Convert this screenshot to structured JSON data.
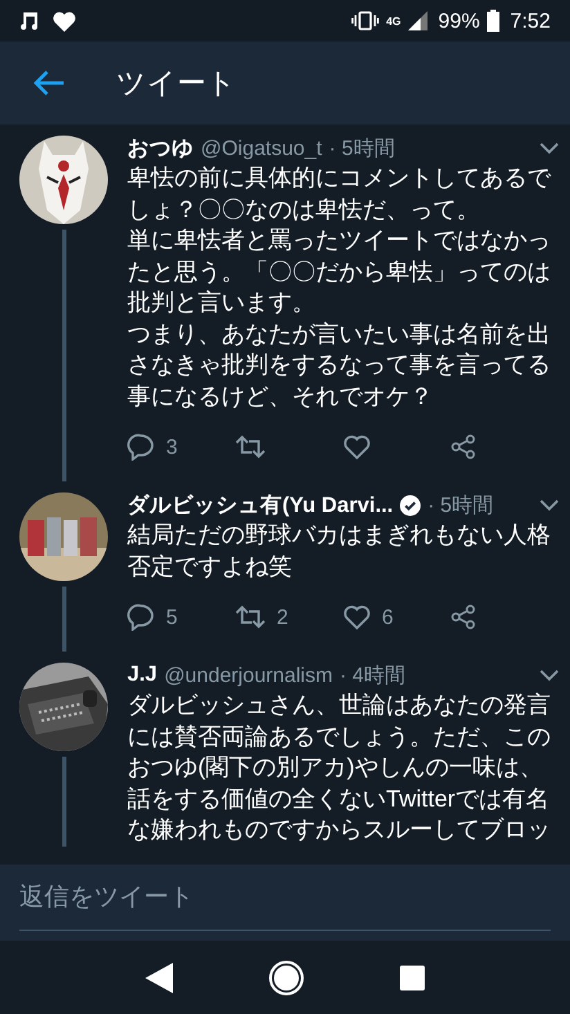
{
  "status_bar": {
    "battery": "99%",
    "time": "7:52",
    "network": "4G"
  },
  "header": {
    "title": "ツイート"
  },
  "tweets": [
    {
      "name": "おつゆ",
      "verified": false,
      "handle": "@Oigatsuo_t",
      "time": "· 5時間",
      "lines": [
        "卑怯の前に具体的にコメントしてあるで",
        "しょ？〇〇なのは卑怯だ、って。",
        "単に卑怯者と罵ったツイートではなかっ",
        "たと思う。「〇〇だから卑怯」ってのは",
        "批判と言います。",
        "つまり、あなたが言いたい事は名前を出",
        "さなきゃ批判をするなって事を言ってる",
        "事になるけど、それでオケ？"
      ],
      "replies": "3"
    },
    {
      "name": "ダルビッシュ有(Yu Darvi...",
      "verified": true,
      "time": "· 5時間",
      "lines": [
        "結局ただの野球バカはまぎれもない人格",
        "否定ですよね笑"
      ],
      "replies": "5",
      "retweets": "2",
      "likes": "6"
    },
    {
      "name": "J.J",
      "verified": false,
      "handle": "@underjournalism",
      "time": "· 4時間",
      "lines": [
        "ダルビッシュさん、世論はあなたの発言",
        "には賛否両論あるでしょう。ただ、この",
        "おつゆ(閣下の別アカ)やしんの一味は、",
        "話をする価値の全くないTwitterでは有名",
        "な嫌われものですからスルーしてブロッ"
      ]
    }
  ],
  "reply_bar": {
    "placeholder": "返信をツイート"
  }
}
